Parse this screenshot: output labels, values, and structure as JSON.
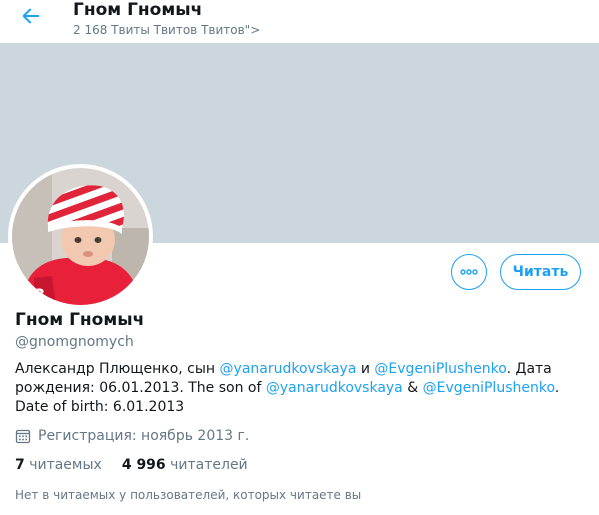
{
  "header": {
    "back_icon": "arrow-left-icon",
    "title": "Гном Гномыч",
    "subtitle": "2 168 Твиты Твитов Твитов\">"
  },
  "colors": {
    "accent": "#1da1f2",
    "banner": "#ccd6dd",
    "secondary_text": "#657786"
  },
  "actions": {
    "more_icon": "more-dots-icon",
    "follow_label": "Читать"
  },
  "profile": {
    "name": "Гном Гномыч",
    "handle": "@gnomgnomych",
    "bio": {
      "t1": "Александр Плющенко, сын ",
      "m1": "@yanarudkovskaya",
      "t2": " и ",
      "m2": "@EvgeniPlushenko",
      "t3": ". Дата рождения: 06.01.2013. The son of ",
      "m3": "@yanarudkovskaya",
      "t4": " & ",
      "m4": "@EvgeniPlushenko",
      "t5": ". Date of birth: 6.01.2013"
    },
    "joined_icon": "calendar-icon",
    "joined": "Регистрация: ноябрь 2013 г."
  },
  "stats": {
    "following_count": "7",
    "following_label": "читаемых",
    "followers_count": "4 996",
    "followers_label": "читателей"
  },
  "note": "Нет в читаемых у пользователей, которых читаете вы"
}
